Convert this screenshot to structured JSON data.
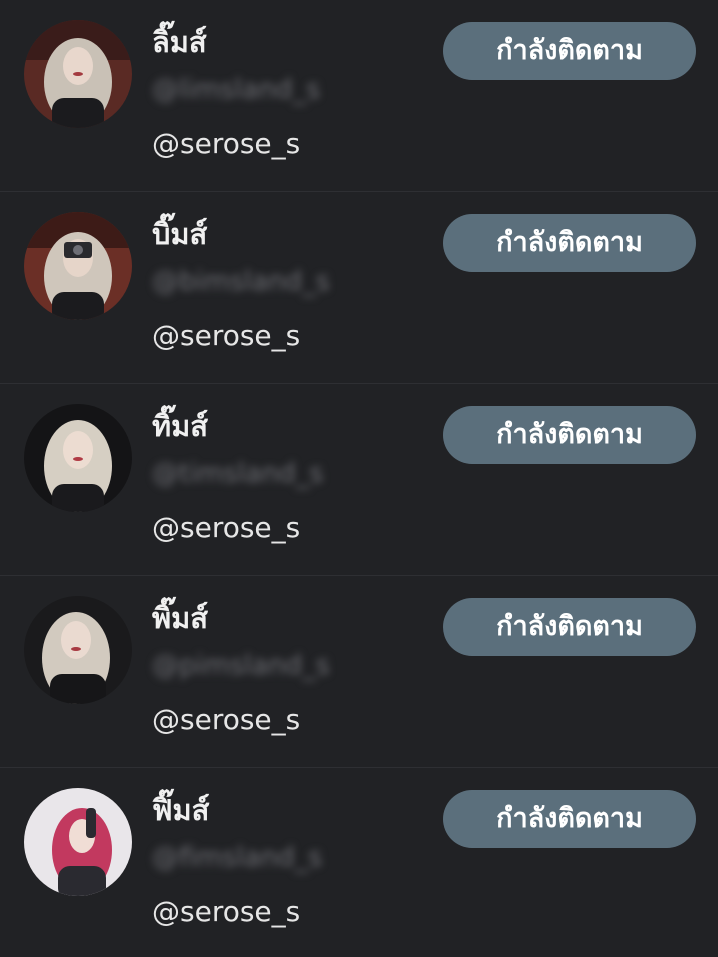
{
  "users": [
    {
      "name": "ลิ๊มส์",
      "blurred_handle": "@limsland_s",
      "handle": "@serose_s",
      "follow_label": "กำลังติดตาม",
      "avatar_bg": "#5a2a24",
      "hair_color": "#c9c1b6"
    },
    {
      "name": "บิ๊มส์",
      "blurred_handle": "@bimsland_s",
      "handle": "@serose_s",
      "follow_label": "กำลังติดตาม",
      "avatar_bg": "#6b2f26",
      "hair_color": "#cfc6bb"
    },
    {
      "name": "ทิ๊มส์",
      "blurred_handle": "@timsland_s",
      "handle": "@serose_s",
      "follow_label": "กำลังติดตาม",
      "avatar_bg": "#141416",
      "hair_color": "#d6cfc3"
    },
    {
      "name": "พิ๊มส์",
      "blurred_handle": "@pimsland_s",
      "handle": "@serose_s",
      "follow_label": "กำลังติดตาม",
      "avatar_bg": "#1a1a1c",
      "hair_color": "#d2cabf"
    },
    {
      "name": "ฟิ๊มส์",
      "blurred_handle": "@fimsland_s",
      "handle": "@serose_s",
      "follow_label": "กำลังติดตาม",
      "avatar_bg": "#e9e6ea",
      "hair_color": "#c2395f"
    }
  ]
}
